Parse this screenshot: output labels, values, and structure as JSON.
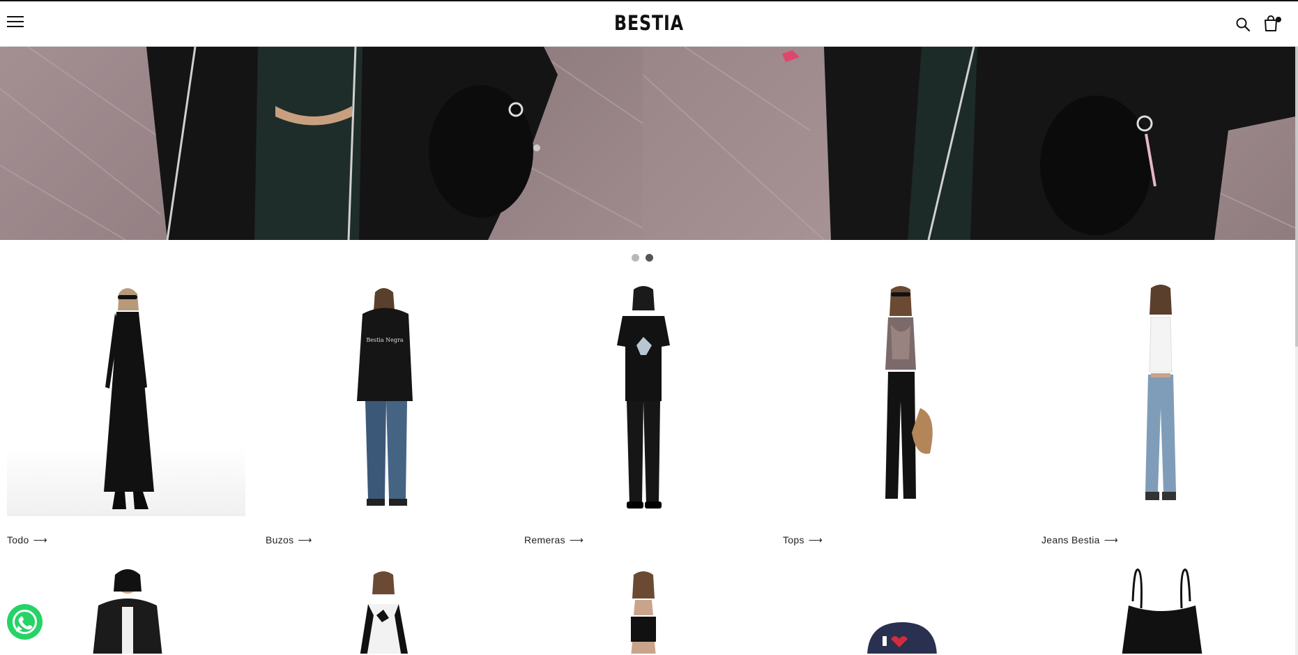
{
  "header": {
    "brand": "BESTIA",
    "menu_icon": "hamburger-menu-icon",
    "search_icon": "search-icon",
    "cart_icon": "shopping-bag-icon"
  },
  "hero": {
    "slides_count": 2,
    "active_slide": 2
  },
  "categories": [
    {
      "label": "Todo",
      "arrow": "⟶"
    },
    {
      "label": "Buzos",
      "arrow": "⟶"
    },
    {
      "label": "Remeras",
      "arrow": "⟶"
    },
    {
      "label": "Tops",
      "arrow": "⟶"
    },
    {
      "label": "Jeans Bestia",
      "arrow": "⟶"
    }
  ],
  "floating": {
    "whatsapp_icon": "whatsapp-icon"
  },
  "colors": {
    "accent": "#111111",
    "whatsapp": "#25d366"
  }
}
